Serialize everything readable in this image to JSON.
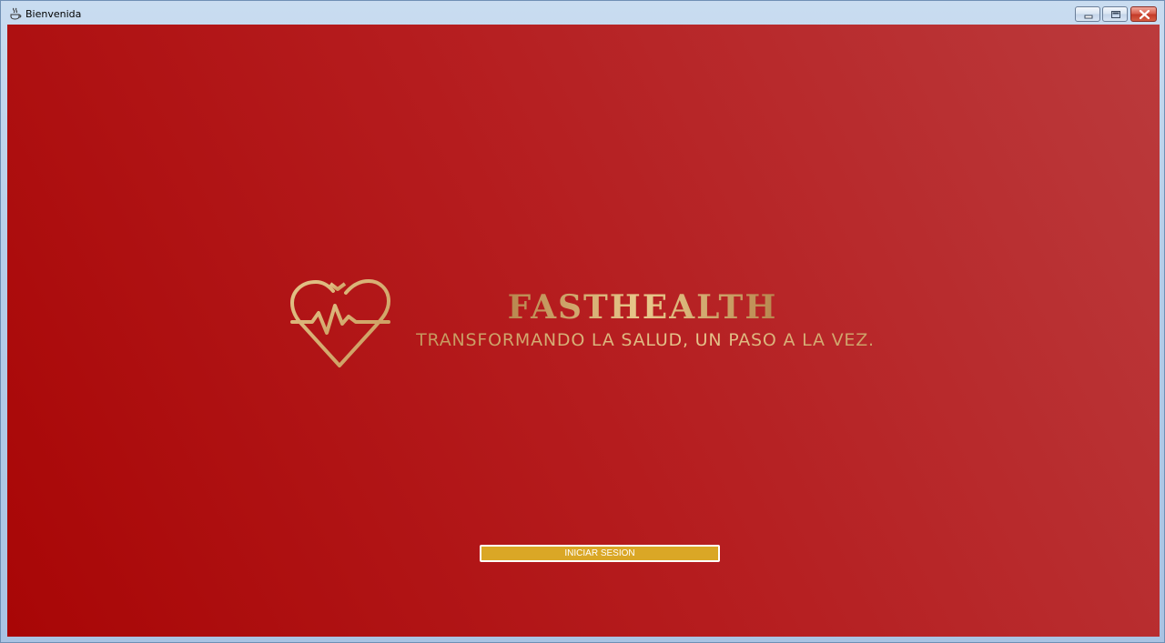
{
  "window": {
    "title": "Bienvenida",
    "controls": {
      "minimize_icon": "minimize-icon",
      "maximize_icon": "maximize-icon",
      "close_icon": "close-icon"
    }
  },
  "brand": {
    "name": "FASTHEALTH",
    "tagline": "TRANSFORMANDO LA SALUD, UN PASO A LA VEZ.",
    "logo_icon": "heart-pulse-icon"
  },
  "actions": {
    "login_label": "INICIAR SESION"
  },
  "colors": {
    "background_start": "#a80606",
    "background_end": "#bb3a3c",
    "gold": "#d9b27a",
    "button_fill": "#daa726",
    "button_border": "#ffffff"
  }
}
